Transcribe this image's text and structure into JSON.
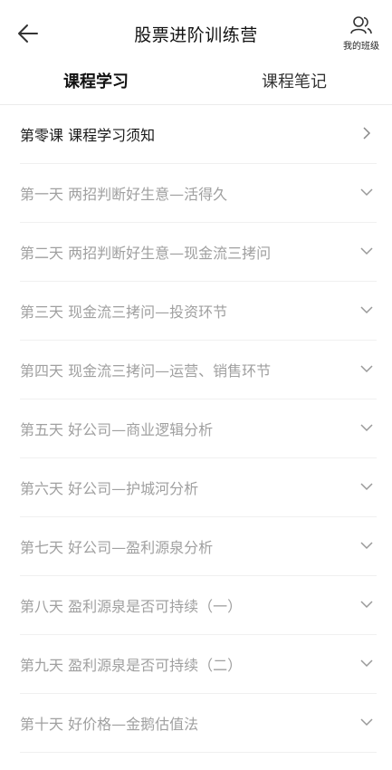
{
  "header": {
    "title": "股票进阶训练营",
    "my_class_label": "我的班级",
    "back_icon": "arrow-left-icon",
    "my_class_icon": "people-icon"
  },
  "tabs": [
    {
      "label": "课程学习",
      "active": true
    },
    {
      "label": "课程笔记",
      "active": false
    }
  ],
  "accent_color": "#f6c545",
  "lessons": [
    {
      "label": "第零课 课程学习须知",
      "icon": "chevron-right-icon"
    },
    {
      "label": "第一天 两招判断好生意—活得久",
      "icon": "chevron-down-icon"
    },
    {
      "label": "第二天 两招判断好生意—现金流三拷问",
      "icon": "chevron-down-icon"
    },
    {
      "label": "第三天 现金流三拷问—投资环节",
      "icon": "chevron-down-icon"
    },
    {
      "label": "第四天 现金流三拷问—运营、销售环节",
      "icon": "chevron-down-icon"
    },
    {
      "label": "第五天 好公司—商业逻辑分析",
      "icon": "chevron-down-icon"
    },
    {
      "label": "第六天 好公司—护城河分析",
      "icon": "chevron-down-icon"
    },
    {
      "label": "第七天 好公司—盈利源泉分析",
      "icon": "chevron-down-icon"
    },
    {
      "label": "第八天 盈利源泉是否可持续（一）",
      "icon": "chevron-down-icon"
    },
    {
      "label": "第九天 盈利源泉是否可持续（二）",
      "icon": "chevron-down-icon"
    },
    {
      "label": "第十天 好价格—金鹅估值法",
      "icon": "chevron-down-icon"
    }
  ]
}
